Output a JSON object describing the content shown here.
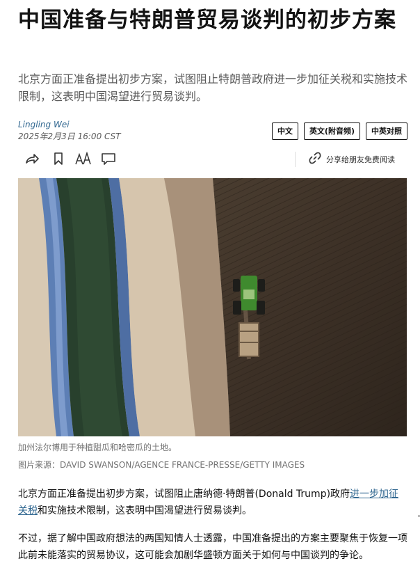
{
  "article": {
    "headline": "中国准备与特朗普贸易谈判的初步方案",
    "summary": "北京方面正准备提出初步方案，试图阻止特朗普政府进一步加征关税和实施技术限制，这表明中国渴望进行贸易谈判。",
    "author": "Lingling Wei",
    "date": "2025年2月3日 16:00 CST"
  },
  "language_buttons": [
    "中文",
    "英文(附音频)",
    "中英对照"
  ],
  "toolbar": {
    "share_label": "分享给朋友免费阅读",
    "icons": [
      "share-arrow-icon",
      "bookmark-icon",
      "text-size-icon",
      "comment-icon",
      "link-icon"
    ]
  },
  "photo": {
    "caption": "加州法尔博用于种植甜瓜和哈密瓜的土地。",
    "credit": "图片来源：DAVID SWANSON/AGENCE FRANCE-PRESSE/GETTY IMAGES"
  },
  "body": {
    "p1_before": "北京方面正准备提出初步方案，试图阻止唐纳德·特朗普(Donald Trump)政府",
    "p1_link": "进一步加征关税",
    "p1_after": "和实施技术限制，这表明中国渴望进行贸易谈判。",
    "p2": "不过，据了解中国政府想法的两国知情人士透露，中国准备提出的方案主要聚焦于恢复一项此前未能落实的贸易协议，这可能会加剧华盛顿方面关于如何与中国谈判的争论。"
  },
  "colors": {
    "link": "#326891",
    "text": "#121212",
    "muted": "#727272"
  }
}
